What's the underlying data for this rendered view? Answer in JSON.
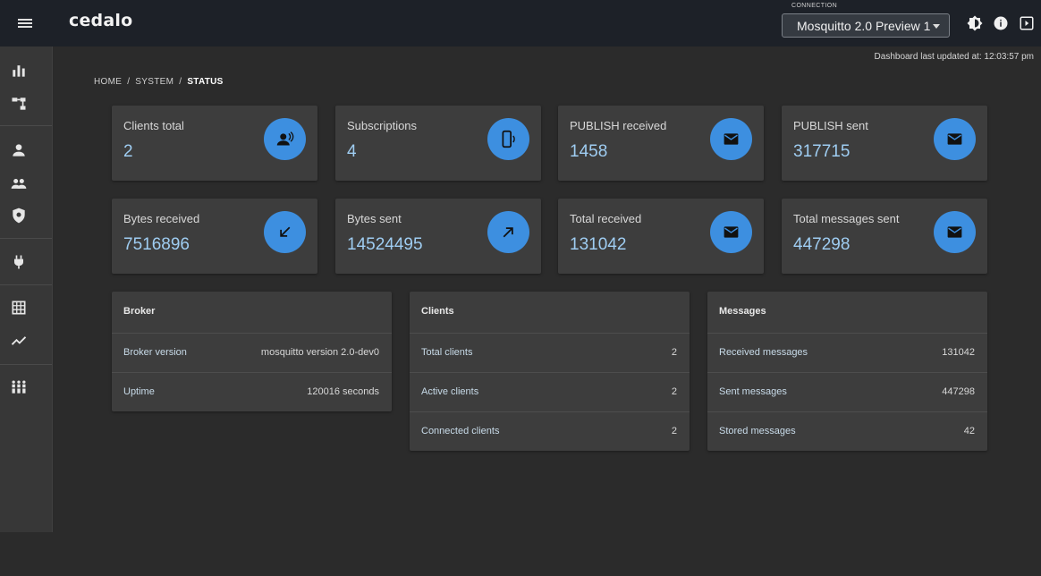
{
  "header": {
    "logo": "cedalo",
    "connection_label": "CONNECTION",
    "connection_value": "Mosquitto 2.0 Preview 1"
  },
  "updated_text": "Dashboard last updated at: 12:03:57 pm",
  "breadcrumb": {
    "home": "HOME",
    "system": "SYSTEM",
    "current": "STATUS"
  },
  "cards": [
    {
      "label": "Clients total",
      "value": "2",
      "icon": "clients-icon"
    },
    {
      "label": "Subscriptions",
      "value": "4",
      "icon": "subscriptions-icon"
    },
    {
      "label": "PUBLISH received",
      "value": "1458",
      "icon": "mail-icon"
    },
    {
      "label": "PUBLISH sent",
      "value": "317715",
      "icon": "mail-icon"
    },
    {
      "label": "Bytes received",
      "value": "7516896",
      "icon": "arrow-down-left-icon"
    },
    {
      "label": "Bytes sent",
      "value": "14524495",
      "icon": "arrow-up-right-icon"
    },
    {
      "label": "Total received",
      "value": "131042",
      "icon": "mail-icon"
    },
    {
      "label": "Total messages sent",
      "value": "447298",
      "icon": "mail-icon"
    }
  ],
  "broker": {
    "title": "Broker",
    "rows": [
      {
        "k": "Broker version",
        "v": "mosquitto version 2.0-dev0"
      },
      {
        "k": "Uptime",
        "v": "120016 seconds"
      }
    ]
  },
  "clients": {
    "title": "Clients",
    "rows": [
      {
        "k": "Total clients",
        "v": "2"
      },
      {
        "k": "Active clients",
        "v": "2"
      },
      {
        "k": "Connected clients",
        "v": "2"
      }
    ]
  },
  "messages": {
    "title": "Messages",
    "rows": [
      {
        "k": "Received messages",
        "v": "131042"
      },
      {
        "k": "Sent messages",
        "v": "447298"
      },
      {
        "k": "Stored messages",
        "v": "42"
      }
    ]
  },
  "colors": {
    "accent": "#3d8fe0",
    "value_text": "#9fcdf2",
    "background": "#2b2b2b",
    "card": "#3d3d3d"
  }
}
